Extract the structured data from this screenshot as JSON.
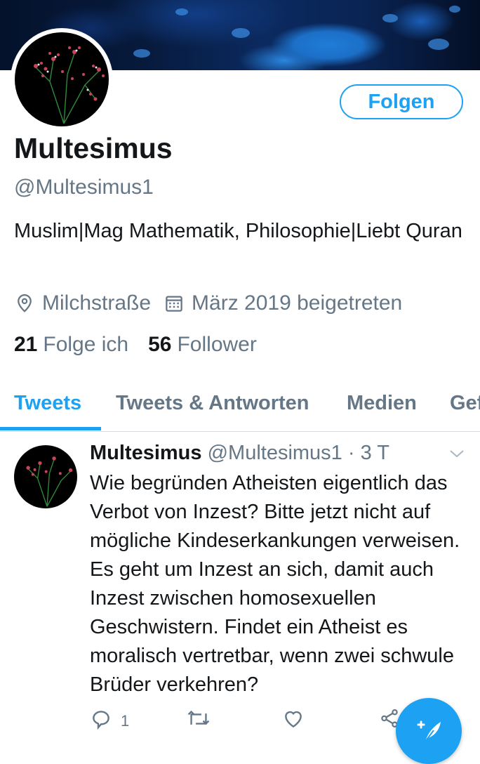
{
  "profile": {
    "follow_label": "Folgen",
    "name": "Multesimus",
    "handle": "@Multesimus1",
    "bio": "Muslim|Mag Mathematik, Philosophie|Liebt Quran",
    "location": "Milchstraße",
    "joined": "März 2019 beigetreten",
    "following_count": "21",
    "following_label": "Folge ich",
    "followers_count": "56",
    "followers_label": "Follower"
  },
  "tabs": [
    {
      "label": "Tweets",
      "active": true
    },
    {
      "label": "Tweets & Antworten",
      "active": false
    },
    {
      "label": "Medien",
      "active": false
    },
    {
      "label": "Gefällt mir",
      "active": false
    }
  ],
  "tweet": {
    "author_name": "Multesimus",
    "author_handle": "@Multesimus1",
    "separator": " · ",
    "time": "3 T",
    "text": "Wie begründen Atheisten eigentlich das Verbot von Inzest? Bitte jetzt nicht auf mögliche Kindeserkankungen verweisen. Es geht um Inzest an sich, damit auch Inzest zwischen homosexuellen Geschwistern. Findet ein Atheist es moralisch vertretbar, wenn zwei schwule Brüder verkehren?",
    "reply_count": "1"
  },
  "icons": {
    "location": "map-pin-icon",
    "calendar": "calendar-icon",
    "reply": "reply-icon",
    "retweet": "retweet-icon",
    "like": "heart-icon",
    "share": "share-icon",
    "compose": "compose-tweet-icon",
    "caret": "chevron-down-icon"
  },
  "colors": {
    "accent": "#1da1f2",
    "secondary_text": "#657786",
    "primary_text": "#14171a"
  }
}
